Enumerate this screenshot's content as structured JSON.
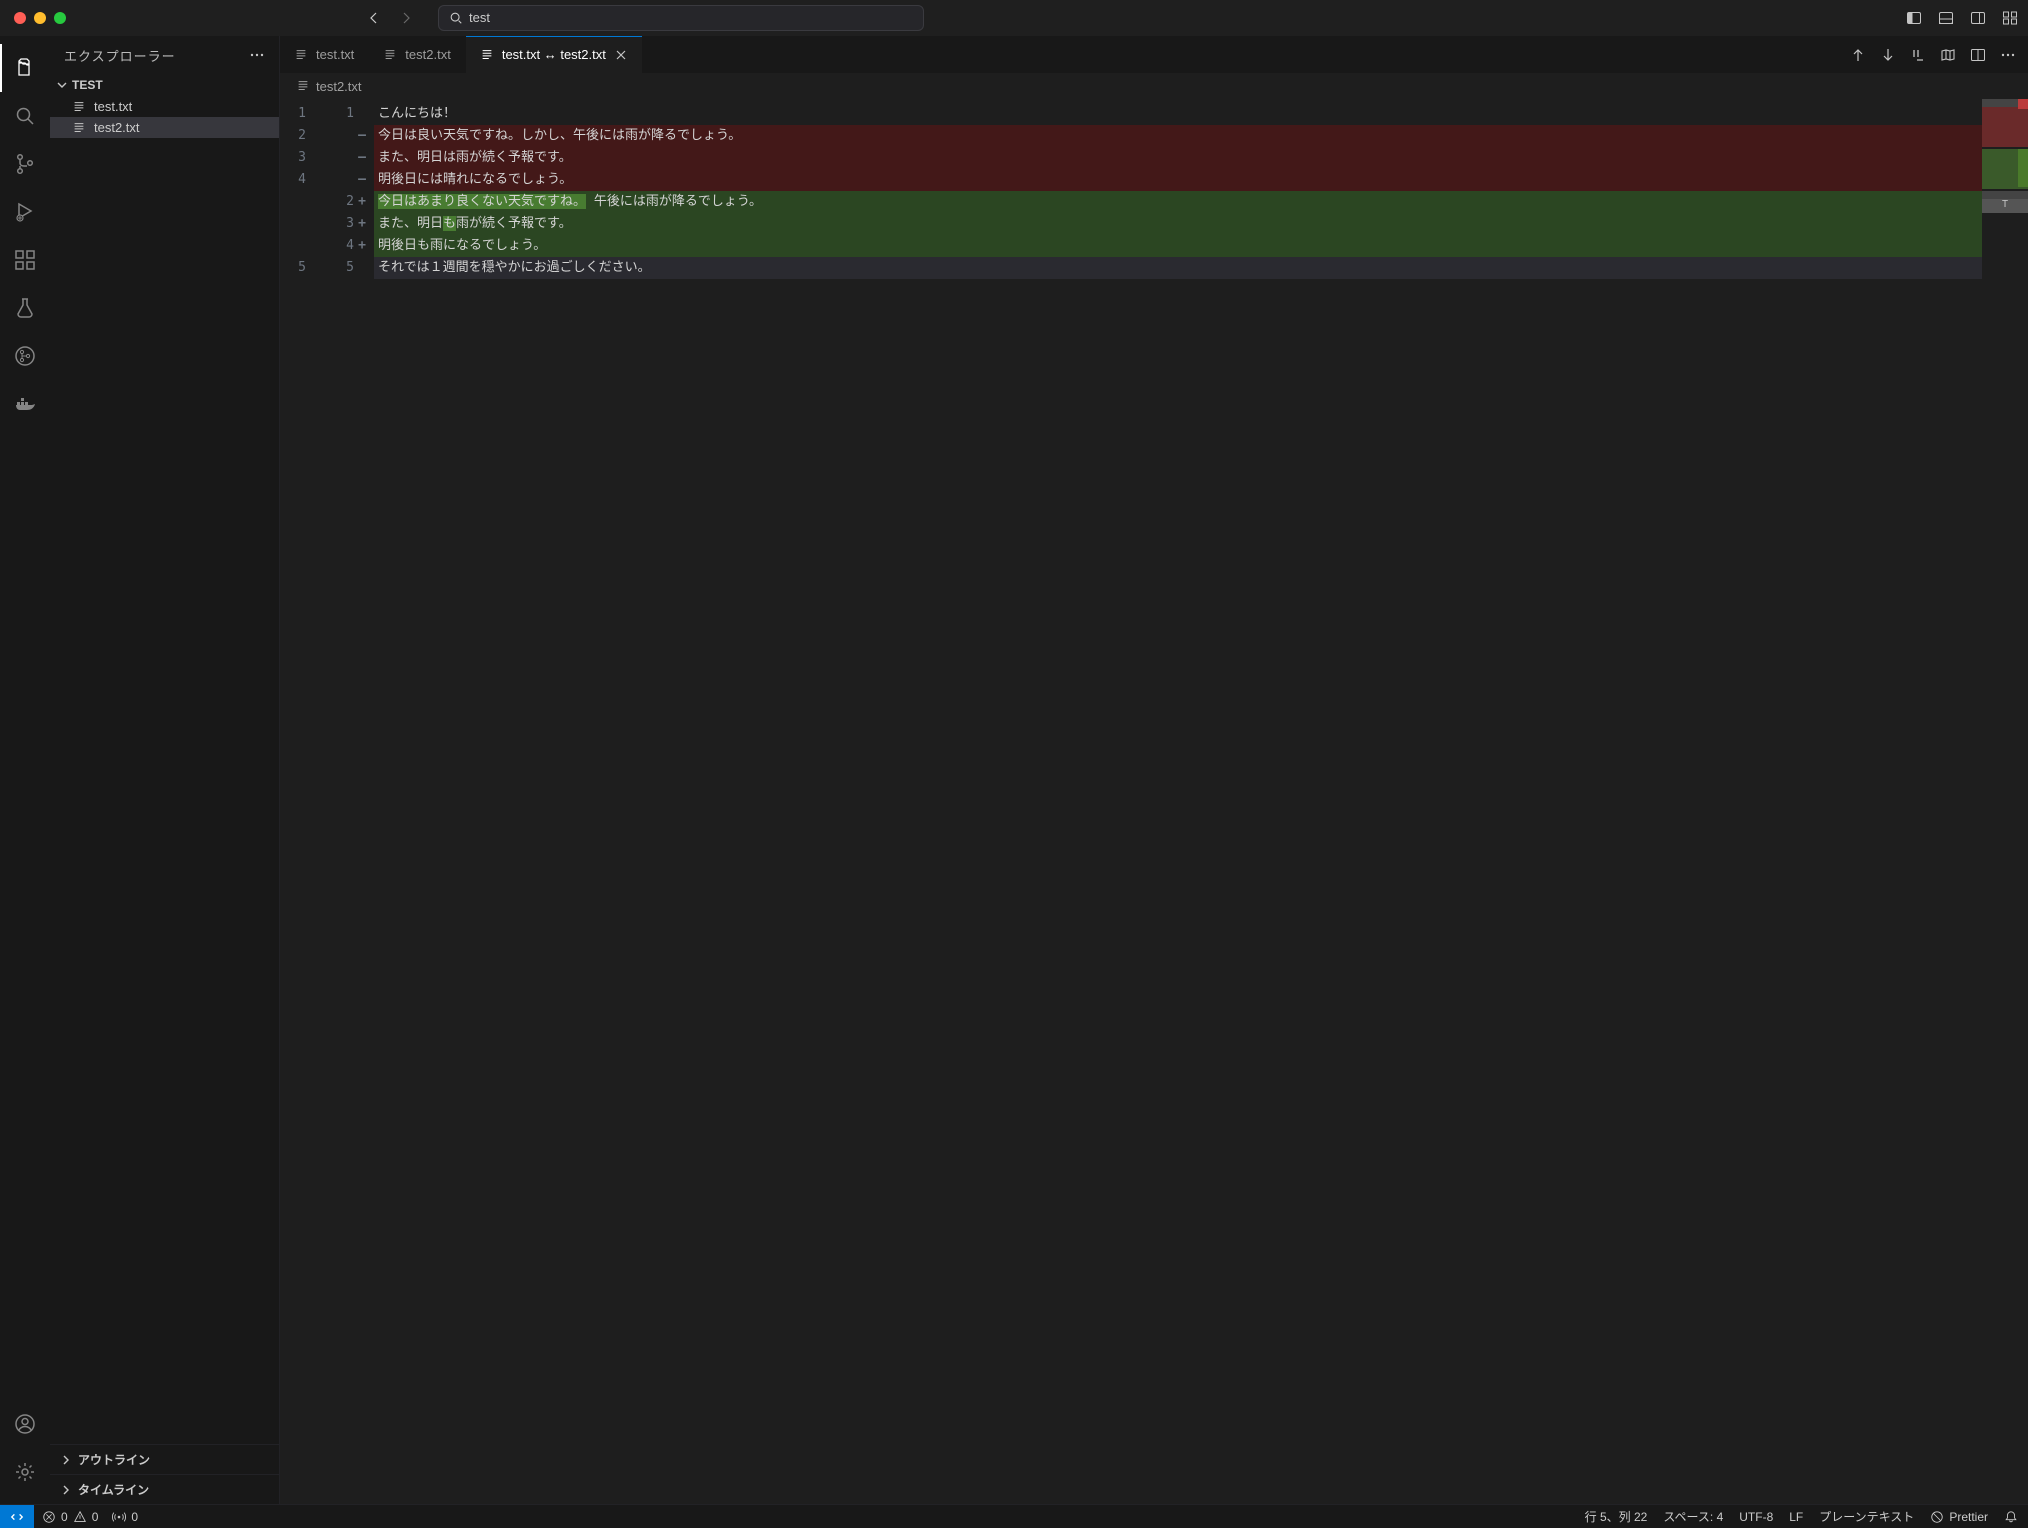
{
  "titlebar": {
    "search": "test"
  },
  "sidebar": {
    "title": "エクスプローラー",
    "folder": "TEST",
    "files": [
      "test.txt",
      "test2.txt"
    ],
    "outline": "アウトライン",
    "timeline": "タイムライン"
  },
  "tabs": {
    "items": [
      "test.txt",
      "test2.txt",
      "test.txt ↔ test2.txt"
    ]
  },
  "breadcrumb": {
    "file": "test2.txt"
  },
  "diff": {
    "left_numbers": [
      "1",
      "2",
      "3",
      "4",
      "",
      "",
      "",
      "5"
    ],
    "right_entries": [
      {
        "n": "1",
        "sign": ""
      },
      {
        "n": "",
        "sign": "—"
      },
      {
        "n": "",
        "sign": "—"
      },
      {
        "n": "",
        "sign": "—"
      },
      {
        "n": "2",
        "sign": "+"
      },
      {
        "n": "3",
        "sign": "+"
      },
      {
        "n": "4",
        "sign": "+"
      },
      {
        "n": "5",
        "sign": ""
      }
    ],
    "lines": [
      {
        "text": "こんにちは！",
        "cls": ""
      },
      {
        "text": "今日は良い天気ですね。しかし、午後には雨が降るでしょう。",
        "cls": "removed"
      },
      {
        "text": "また、明日は雨が続く予報です。",
        "cls": "removed"
      },
      {
        "text": "明後日には晴れになるでしょう。",
        "cls": "removed"
      },
      {
        "text_a": "今日はあまり良くない天気ですね。",
        "text_b": "午後には雨が降るでしょう。",
        "cls": "added",
        "split": true
      },
      {
        "text_a": "また、明日",
        "text_b": "も",
        "text_c": "雨が続く予報です。",
        "cls": "added",
        "word": true
      },
      {
        "text": "明後日も雨になるでしょう。",
        "cls": "added"
      },
      {
        "text": "それでは１週間を穏やかにお過ごしください。",
        "cls": "cur-line"
      }
    ]
  },
  "status": {
    "errors": "0",
    "warnings": "0",
    "ports": "0",
    "line_col": "行 5、列 22",
    "spaces": "スペース: 4",
    "encoding": "UTF-8",
    "eol": "LF",
    "lang": "プレーンテキスト",
    "prettier": "Prettier"
  }
}
